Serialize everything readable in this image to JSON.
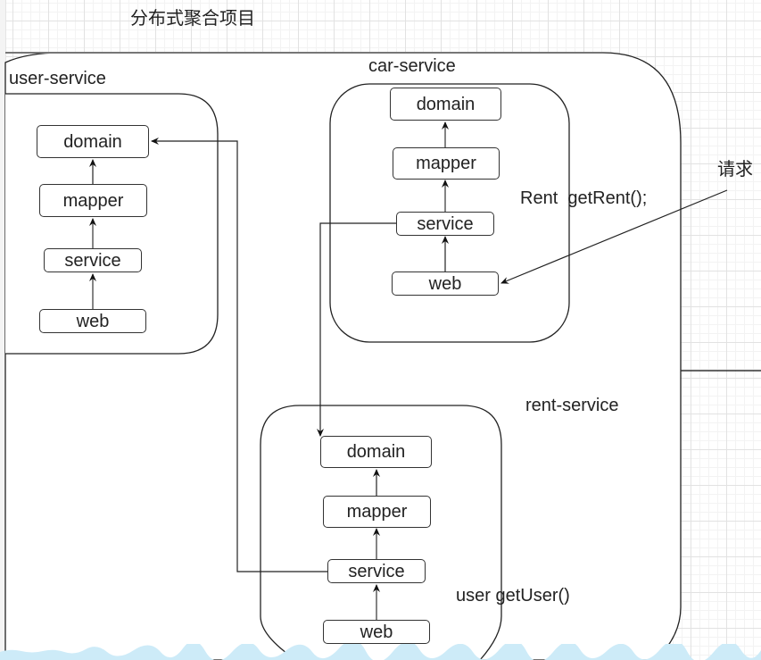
{
  "title": "分布式聚合项目",
  "containers": {
    "rent_service_outer": {
      "label": "rent-service"
    },
    "user_service": {
      "label": "user-service"
    },
    "car_service": {
      "label": "car-service"
    },
    "rent_service_inner": {
      "label": ""
    }
  },
  "user_service": {
    "nodes": {
      "domain": "domain",
      "mapper": "mapper",
      "service": "service",
      "web": "web"
    }
  },
  "car_service": {
    "nodes": {
      "domain": "domain",
      "mapper": "mapper",
      "service": "service",
      "web": "web"
    }
  },
  "rent_service": {
    "nodes": {
      "domain": "domain",
      "mapper": "mapper",
      "service": "service",
      "web": "web"
    }
  },
  "annotations": {
    "request": "请求",
    "rent_method": "Rent  getRent();",
    "user_method": "user getUser()"
  },
  "colors": {
    "stroke": "#222222",
    "grid": "#e2e2e2",
    "water": "#cdebf8"
  }
}
